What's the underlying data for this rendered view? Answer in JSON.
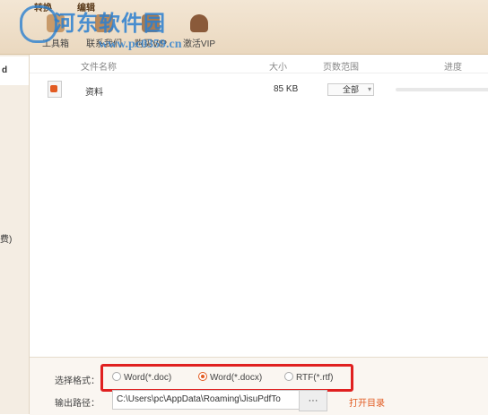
{
  "topmenu": {
    "item1": "转换",
    "item2": "编辑"
  },
  "toolbar": {
    "items": [
      {
        "label": "工具箱"
      },
      {
        "label": "联系我们"
      },
      {
        "label": "购买VIP"
      },
      {
        "label": "激活VIP"
      }
    ]
  },
  "watermark": {
    "title": "河东软件园",
    "url": "www.pc0359.cn"
  },
  "sidebar": {
    "item_selected": "d",
    "item_other": "费)"
  },
  "table": {
    "headers": [
      "文件名称",
      "大小",
      "页数范围",
      "进度"
    ],
    "rows": [
      {
        "name": "资料",
        "size": "85 KB",
        "pages": "全部"
      }
    ]
  },
  "bottom": {
    "format_label": "选择格式：",
    "formats": [
      "Word(*.doc)",
      "Word(*.docx)",
      "RTF(*.rtf)"
    ],
    "selected_format": "Word(*.docx)",
    "output_label": "输出路径：",
    "output_path": "C:\\Users\\pc\\AppData\\Roaming\\JisuPdfTo",
    "browse_label": "···",
    "open_dir_label": "打开目录"
  },
  "colors": {
    "accent": "#e25b22",
    "highlight": "#e02020",
    "toolbar_bg": "#efe0c9"
  }
}
